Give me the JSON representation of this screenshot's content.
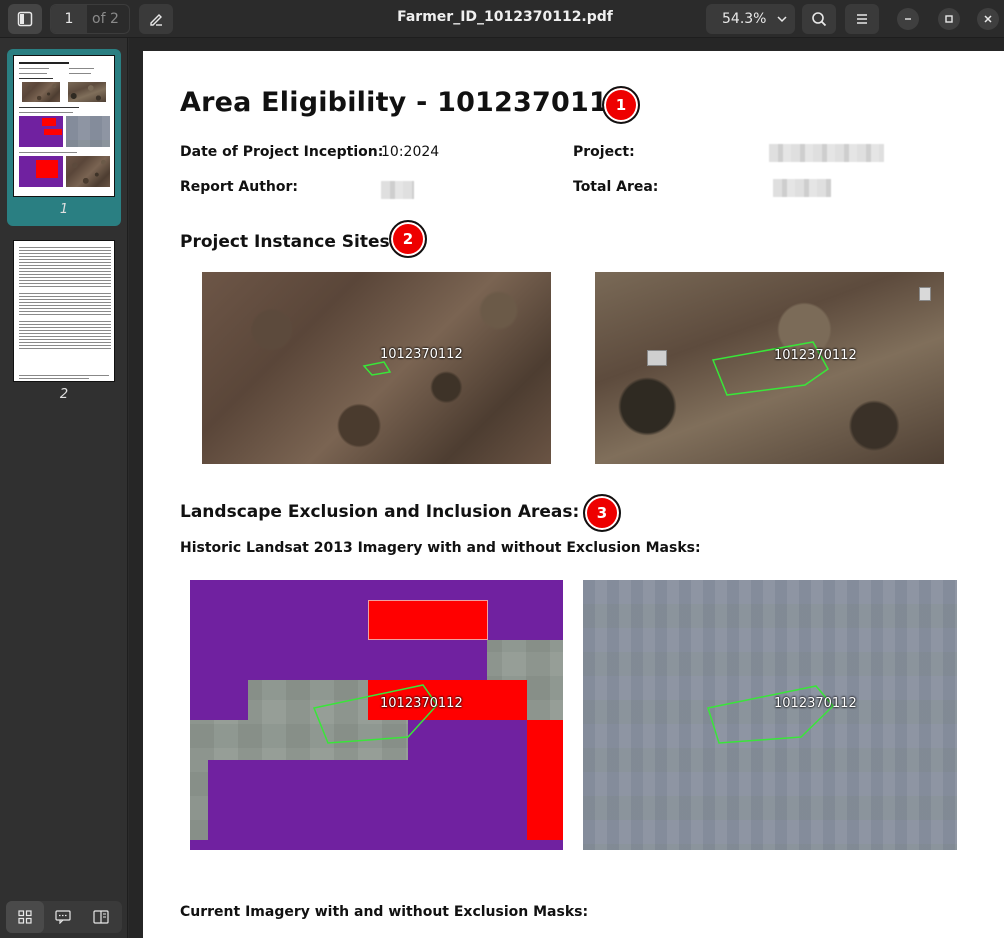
{
  "toolbar": {
    "page_current": "1",
    "page_total": "of 2",
    "file_title": "Farmer_ID_1012370112.pdf",
    "zoom": "54.3%"
  },
  "sidebar": {
    "thumbnails": [
      {
        "label": "1",
        "selected": true
      },
      {
        "label": "2",
        "selected": false
      }
    ],
    "accent_color": "#2a7f82"
  },
  "document": {
    "title": "Area Eligibility - 1012370112",
    "fields": {
      "date_label": "Date of Project Inception:",
      "date_value": "10:2024",
      "author_label": "Report Author:",
      "project_label": "Project:",
      "total_area_label": "Total Area:"
    },
    "section_sites": "Project Instance Sites:",
    "section_landscape": "Landscape Exclusion and Inclusion Areas:",
    "subsection_historic": "Historic Landsat 2013 Imagery with and without Exclusion Masks:",
    "subsection_current": "Current Imagery with and without Exclusion Masks:",
    "polygon_label": "1012370112",
    "badges": [
      "1",
      "2",
      "3"
    ],
    "colors": {
      "badge_red": "#e00000",
      "mask_purple": "#7021a0",
      "mask_red": "#ff0000",
      "polygon_green": "#39e639"
    }
  }
}
